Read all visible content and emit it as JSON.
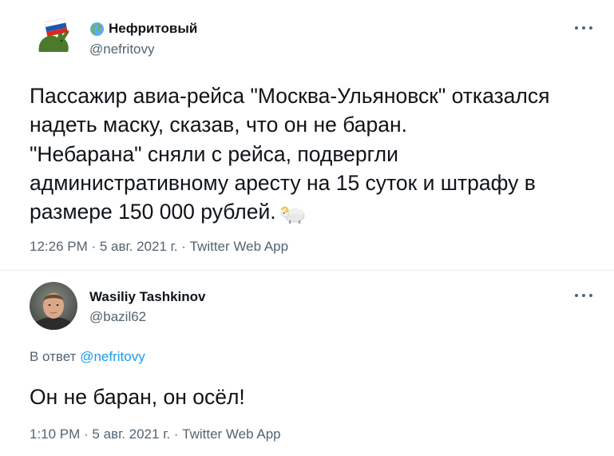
{
  "tweet1": {
    "name": "Нефритовый",
    "handle": "@nefritovy",
    "text_lines": [
      "Пассажир авиа-рейса \"Москва-Ульяновск\" отказался",
      "надеть маску, сказав, что он не баран.",
      "\"Небарана\" сняли с рейса, подвергли",
      "административному аресту на 15 суток и штрафу в",
      "размере 150 000 рублей."
    ],
    "emoji": "ram-icon",
    "meta": "12:26 PM · 5 авг. 2021 г. · Twitter Web App"
  },
  "tweet2": {
    "name": "Wasiliy Tashkinov",
    "handle": "@bazil62",
    "reply_prefix": "В ответ",
    "reply_handle": "@nefritovy",
    "text": "Он не баран, он осёл!",
    "meta": "1:10 PM · 5 авг. 2021 г. · Twitter Web App"
  },
  "colors": {
    "text": "#0f1419",
    "secondary": "#536471",
    "link": "#1d9bf0",
    "divider": "#e6ecf0"
  }
}
